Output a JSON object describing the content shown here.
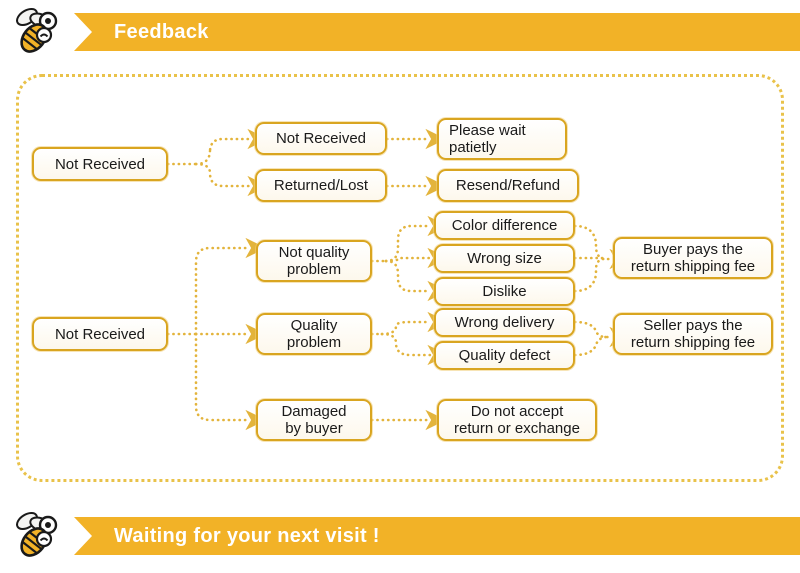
{
  "header": {
    "title": "Feedback",
    "icon": "bee-icon",
    "watermark": "",
    "accent_color": "#F2B227"
  },
  "footer": {
    "title": "Waiting for your next visit !",
    "icon": "bee-icon",
    "accent_color": "#F2B227"
  },
  "frame": {
    "border_color": "#E9C24A",
    "border_style": "dotted"
  },
  "flow": {
    "node_border_color": "#D9A520",
    "connector_color": "#E3B43C",
    "nodes": {
      "root_not_received_1": "Not Received",
      "not_received_2": "Not Received",
      "returned_lost": "Returned/Lost",
      "please_wait": "Please wait\npatietly",
      "resend_refund": "Resend/Refund",
      "root_not_received_2": "Not Received",
      "not_quality_problem": "Not quality\nproblem",
      "quality_problem": "Quality\nproblem",
      "damaged_by_buyer": "Damaged\nby buyer",
      "color_difference": "Color difference",
      "wrong_size": "Wrong size",
      "dislike": "Dislike",
      "wrong_delivery": "Wrong delivery",
      "quality_defect": "Quality defect",
      "buyer_pays": "Buyer pays the\nreturn shipping fee",
      "seller_pays": "Seller pays the\nreturn shipping fee",
      "do_not_accept": "Do not accept\nreturn or exchange"
    }
  }
}
